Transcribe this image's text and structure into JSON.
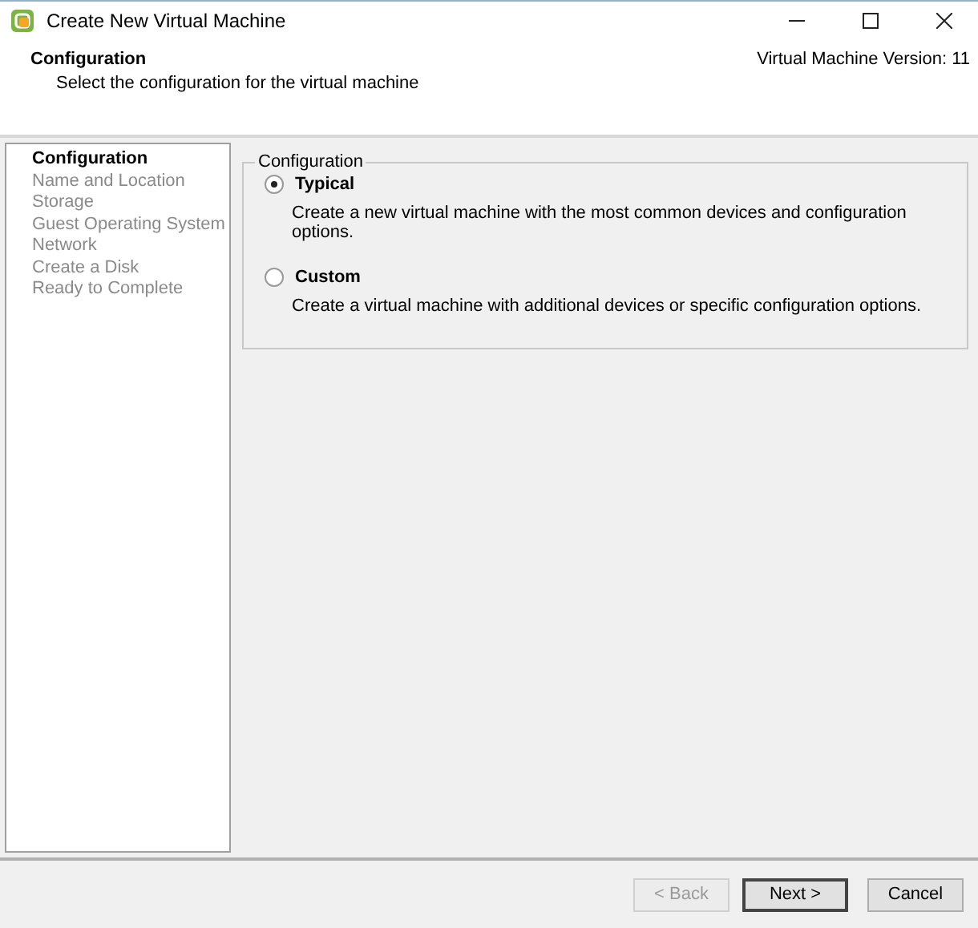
{
  "window": {
    "title": "Create New Virtual Machine"
  },
  "header": {
    "title": "Configuration",
    "subtitle": "Select the configuration for the virtual machine",
    "version": "Virtual Machine Version: 11"
  },
  "steps": [
    {
      "label": "Configuration",
      "selected": true
    },
    {
      "label": "Name and Location",
      "selected": false
    },
    {
      "label": "Storage",
      "selected": false
    },
    {
      "label": "Guest Operating System",
      "selected": false
    },
    {
      "label": "Network",
      "selected": false
    },
    {
      "label": "Create a Disk",
      "selected": false
    },
    {
      "label": "Ready to Complete",
      "selected": false
    }
  ],
  "group": {
    "title": "Configuration",
    "options": [
      {
        "label": "Typical",
        "description": "Create a new virtual machine with the most common devices and configuration options.",
        "selected": true
      },
      {
        "label": "Custom",
        "description": "Create a virtual machine with additional devices or specific configuration options.",
        "selected": false
      }
    ]
  },
  "buttons": [
    {
      "label": "< Back",
      "disabled": true,
      "default": false
    },
    {
      "label": "Next >",
      "disabled": false,
      "default": true
    },
    {
      "label": "Cancel",
      "disabled": false,
      "default": false
    }
  ]
}
